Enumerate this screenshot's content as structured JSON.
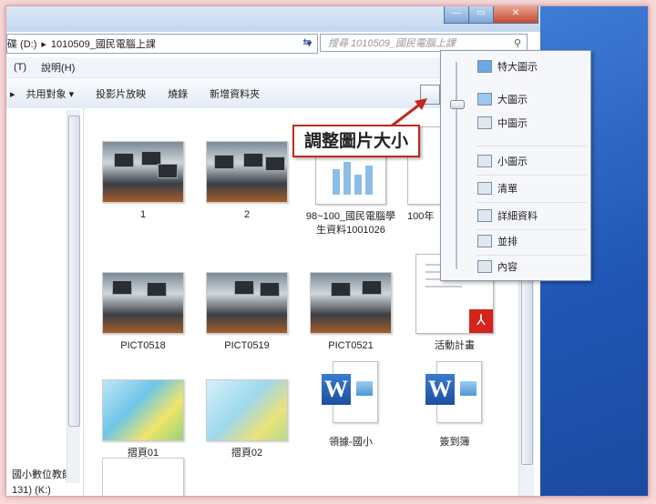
{
  "address": {
    "drive": "碟 (D:)",
    "folder": "1010509_國民電腦上課"
  },
  "search": {
    "placeholder": "搜尋 1010509_國民電腦上課"
  },
  "menu": [
    "(T)",
    "說明(H)"
  ],
  "toolbar": {
    "share": "共用對象",
    "slideshow": "投影片放映",
    "burn": "燒錄",
    "new_folder": "新增資料夾"
  },
  "nav": {
    "item1": "國小數位教師",
    "item2": "131) (K:)"
  },
  "files": [
    {
      "label": "1"
    },
    {
      "label": "2"
    },
    {
      "label": "98~100_國民電腦學生資料1001026"
    },
    {
      "label": "100年"
    },
    {
      "label": "PICT0518"
    },
    {
      "label": "PICT0519"
    },
    {
      "label": "PICT0521"
    },
    {
      "label": "活動計畫"
    },
    {
      "label": "摺頁01"
    },
    {
      "label": "摺頁02"
    },
    {
      "label": "領據-國小"
    },
    {
      "label": "簽到簿"
    }
  ],
  "view_menu": {
    "extra_large": "特大圖示",
    "large": "大圖示",
    "medium": "中圖示",
    "small": "小圖示",
    "list": "清單",
    "details": "詳細資料",
    "tiles": "並排",
    "content": "內容"
  },
  "callout": "調整圖片大小",
  "colors": {
    "callout_border": "#c0281e",
    "arrow": "#c0281e",
    "desktop": "#2157b5"
  }
}
